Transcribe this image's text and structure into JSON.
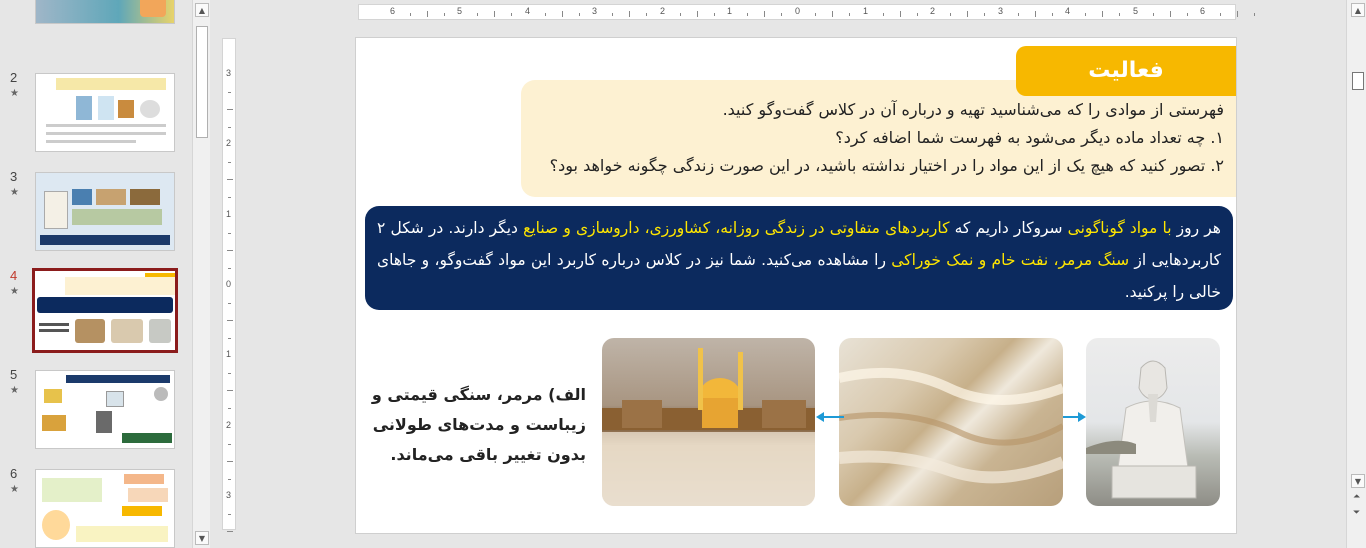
{
  "thumbnails": [
    {
      "number": "",
      "star": "",
      "active": false
    },
    {
      "number": "2",
      "star": "★",
      "active": false
    },
    {
      "number": "3",
      "star": "★",
      "active": false
    },
    {
      "number": "4",
      "star": "★",
      "active": true
    },
    {
      "number": "5",
      "star": "★",
      "active": false
    },
    {
      "number": "6",
      "star": "★",
      "active": false
    }
  ],
  "ruler": {
    "horizontal": [
      "6",
      "5",
      "4",
      "3",
      "2",
      "1",
      "0",
      "1",
      "2",
      "3",
      "4",
      "5",
      "6"
    ],
    "vertical": [
      "3",
      "2",
      "1",
      "0",
      "1",
      "2",
      "3"
    ]
  },
  "slide": {
    "activity_title": "فعالیت",
    "activity_lines": [
      "فهرستی از موادی را که می‌شناسید تهیه و درباره آن در کلاس گفت‌وگو کنید.",
      "۱. چه تعداد ماده دیگر می‌شود به فهرست شما اضافه کرد؟",
      "۲. تصور کنید که هیچ یک از این مواد را در اختیار نداشته باشید، در این صورت زندگی چگونه خواهد بود؟"
    ],
    "blue": {
      "t1": "هر روز ",
      "h1": "با مواد گوناگونی",
      "t2": " سروکار داریم که ",
      "h2": "کاربردهای متفاوتی در زندگی روزانه، کشاورزی، داروسازی و صنایع",
      "t3": " دیگر دارند. در شکل ۲ کاربردهایی از ",
      "h3": "سنگ مرمر، نفت خام و نمک خوراکی",
      "t4": " را مشاهده می‌کنید. شما نیز در کلاس درباره کاربرد این مواد گفت‌وگو، و جاهای خالی را پرکنید."
    },
    "caption": "الف) مرمر، سنگی قیمتی و زیباست و مدت‌های طولانی بدون تغییر باقی می‌ماند."
  },
  "colors": {
    "accent": "#f7b800",
    "blue_box": "#0c2a5e",
    "highlight": "#ffe600",
    "arrow": "#1e9ad6"
  }
}
